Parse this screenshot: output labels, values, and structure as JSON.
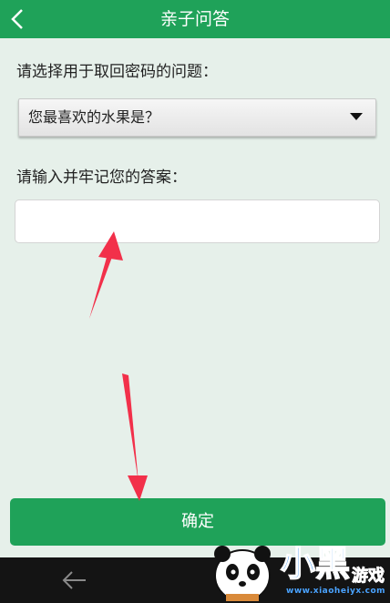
{
  "header": {
    "title": "亲子问答",
    "back_icon": "chevron-left-icon"
  },
  "form": {
    "question_label": "请选择用于取回密码的问题：",
    "question_selected": "您最喜欢的水果是？",
    "answer_label": "请输入并牢记您的答案：",
    "answer_value": "",
    "answer_placeholder": ""
  },
  "confirm_label": "确定",
  "nav": {
    "back_icon": "arrow-left-icon"
  },
  "watermark": {
    "site": "www.xiaoheiyx.com",
    "brand_glyphs": [
      "小",
      "黑",
      "游戏"
    ]
  },
  "colors": {
    "primary": "#1fa259",
    "background": "#e6f0ea",
    "annotation_arrow": "#f2304a",
    "navbar": "#141414"
  }
}
